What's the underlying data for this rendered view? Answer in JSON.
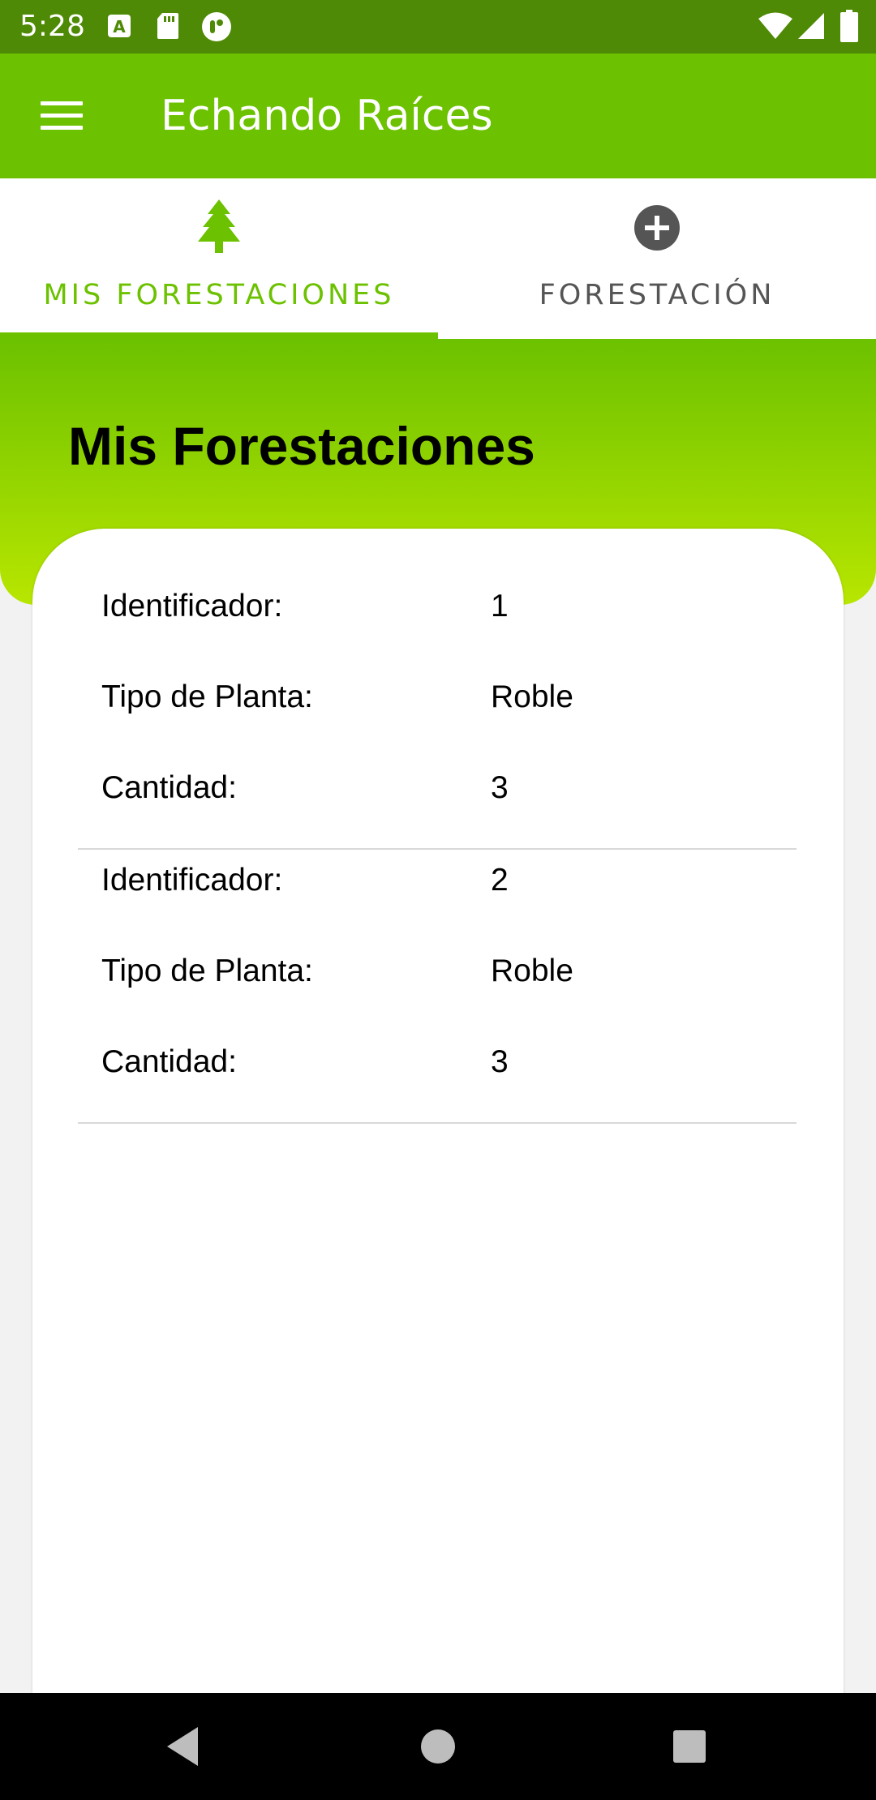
{
  "status_bar": {
    "time": "5:28",
    "left_icons": [
      "font-a-icon",
      "sd-card-icon",
      "app-notification-icon"
    ],
    "right_icons": [
      "wifi-icon",
      "cell-signal-icon",
      "battery-icon"
    ],
    "background_color": "#4e8a05"
  },
  "app_bar": {
    "title": "Echando Raíces",
    "menu_icon": "menu-icon",
    "background_color": "#6cc100"
  },
  "tabs": [
    {
      "label": "MIS FORESTACIONES",
      "icon": "tree-icon",
      "selected": true,
      "color": "#6cc100"
    },
    {
      "label": "FORESTACIÓN",
      "icon": "add-circle-icon",
      "selected": false,
      "color": "#555555"
    }
  ],
  "page": {
    "title": "Mis Forestaciones"
  },
  "forestations": [
    {
      "rows": [
        {
          "label": "Identificador:",
          "value": "1"
        },
        {
          "label": "Tipo de Planta:",
          "value": "Roble"
        },
        {
          "label": "Cantidad:",
          "value": "3"
        }
      ]
    },
    {
      "rows": [
        {
          "label": "Identificador:",
          "value": "2"
        },
        {
          "label": "Tipo de Planta:",
          "value": "Roble"
        },
        {
          "label": "Cantidad:",
          "value": "3"
        }
      ]
    }
  ],
  "nav_bar": {
    "buttons": [
      "back-icon",
      "home-icon",
      "recents-icon"
    ]
  }
}
